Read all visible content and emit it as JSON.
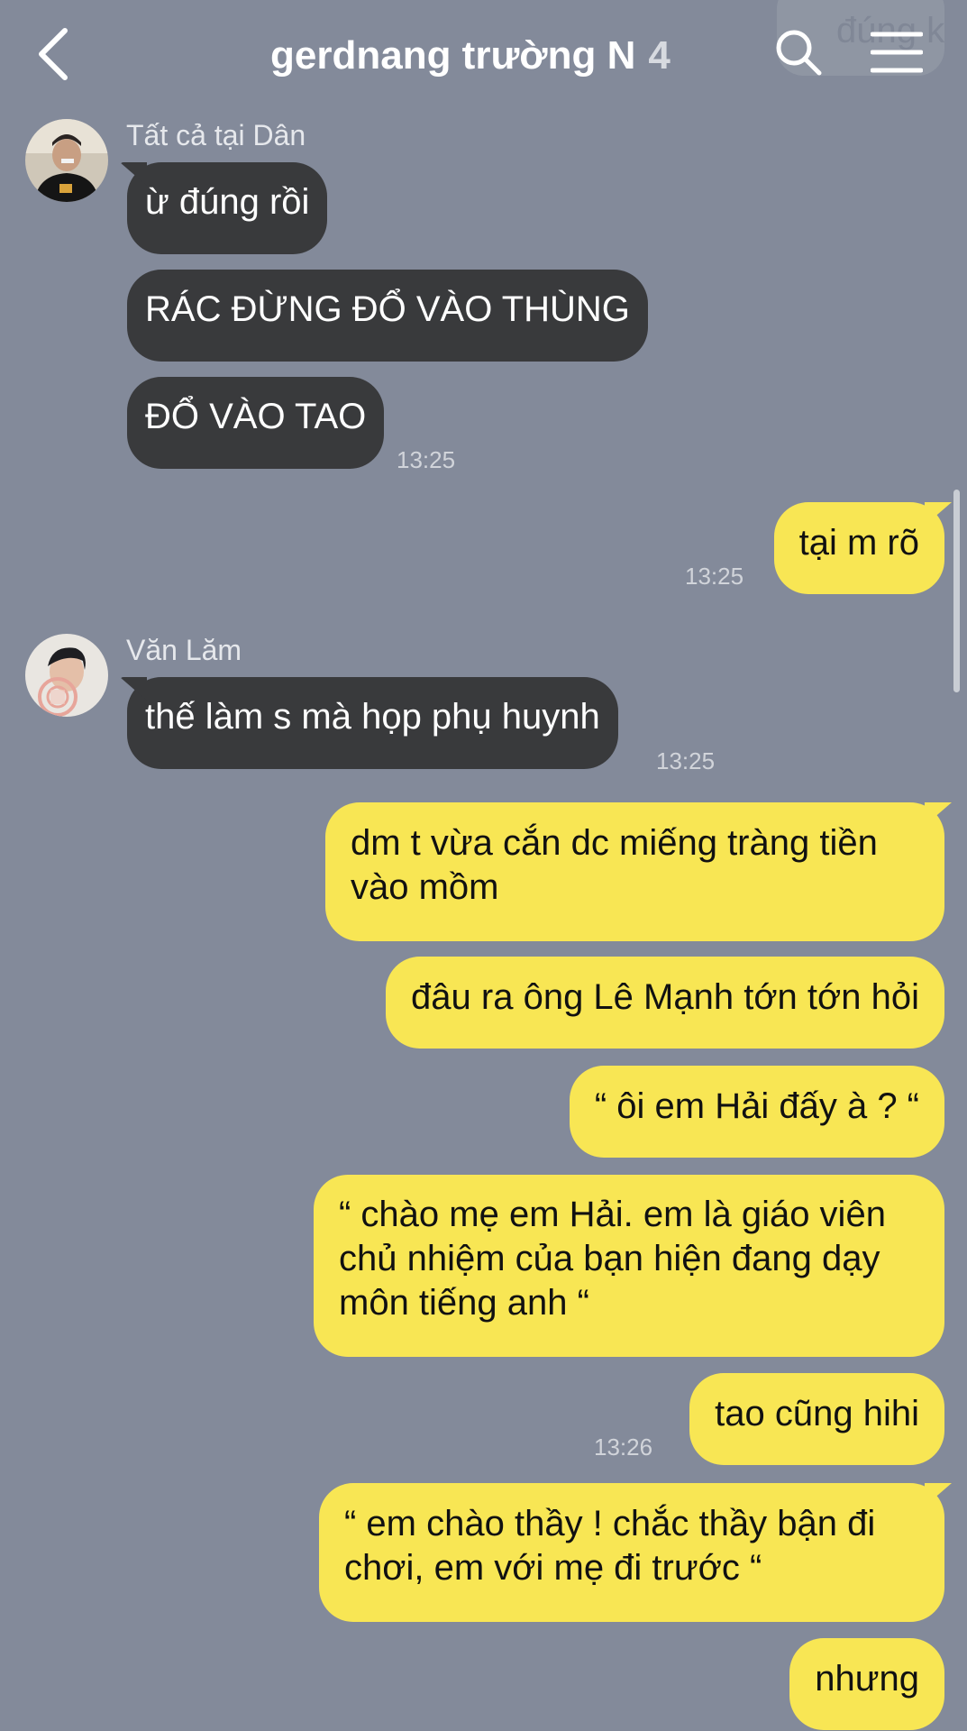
{
  "header": {
    "title": "gerdnang trường N",
    "member_count": "4",
    "ghost_preview_text": "đúng k"
  },
  "messages": [
    {
      "id": "m1",
      "direction": "incoming",
      "sender": "Tất cả tại Dân",
      "text": "ừ đúng rồi"
    },
    {
      "id": "m2",
      "direction": "incoming",
      "text": "RÁC ĐỪNG ĐỔ VÀO THÙNG"
    },
    {
      "id": "m3",
      "direction": "incoming",
      "text": "ĐỔ VÀO TAO",
      "time": "13:25"
    },
    {
      "id": "m4",
      "direction": "outgoing",
      "text": "tại m rõ",
      "time": "13:25"
    },
    {
      "id": "m5",
      "direction": "incoming",
      "sender": "Văn Lăm",
      "text": "thế làm s mà họp phụ huynh",
      "time": "13:25"
    },
    {
      "id": "m6",
      "direction": "outgoing",
      "lines": [
        "dm t vừa cắn dc miếng tràng tiền",
        "vào mồm"
      ]
    },
    {
      "id": "m7",
      "direction": "outgoing",
      "text": "đâu ra ông Lê Mạnh tớn tớn hỏi"
    },
    {
      "id": "m8",
      "direction": "outgoing",
      "text": "“ ôi em Hải đấy à ? “"
    },
    {
      "id": "m9",
      "direction": "outgoing",
      "lines": [
        "“ chào mẹ em Hải. em là giáo viên",
        "chủ nhiệm của bạn hiện đang dạy",
        "môn tiếng anh “"
      ]
    },
    {
      "id": "m10",
      "direction": "outgoing",
      "text": "tao cũng hihi",
      "time": "13:26"
    },
    {
      "id": "m11",
      "direction": "outgoing",
      "lines": [
        "“ em chào thầy ! chắc thầy bận đi",
        "chơi, em với mẹ đi trước “"
      ]
    },
    {
      "id": "m12",
      "direction": "outgoing",
      "text": "nhưng"
    }
  ],
  "icons": {
    "back": "chevron-left-icon",
    "search": "search-icon",
    "menu": "hamburger-menu-icon"
  },
  "colors": {
    "background": "#838A9A",
    "incoming_bubble": "#393A3C",
    "outgoing_bubble": "#F8E654",
    "incoming_text": "#FFFFFF",
    "outgoing_text": "#111111"
  }
}
